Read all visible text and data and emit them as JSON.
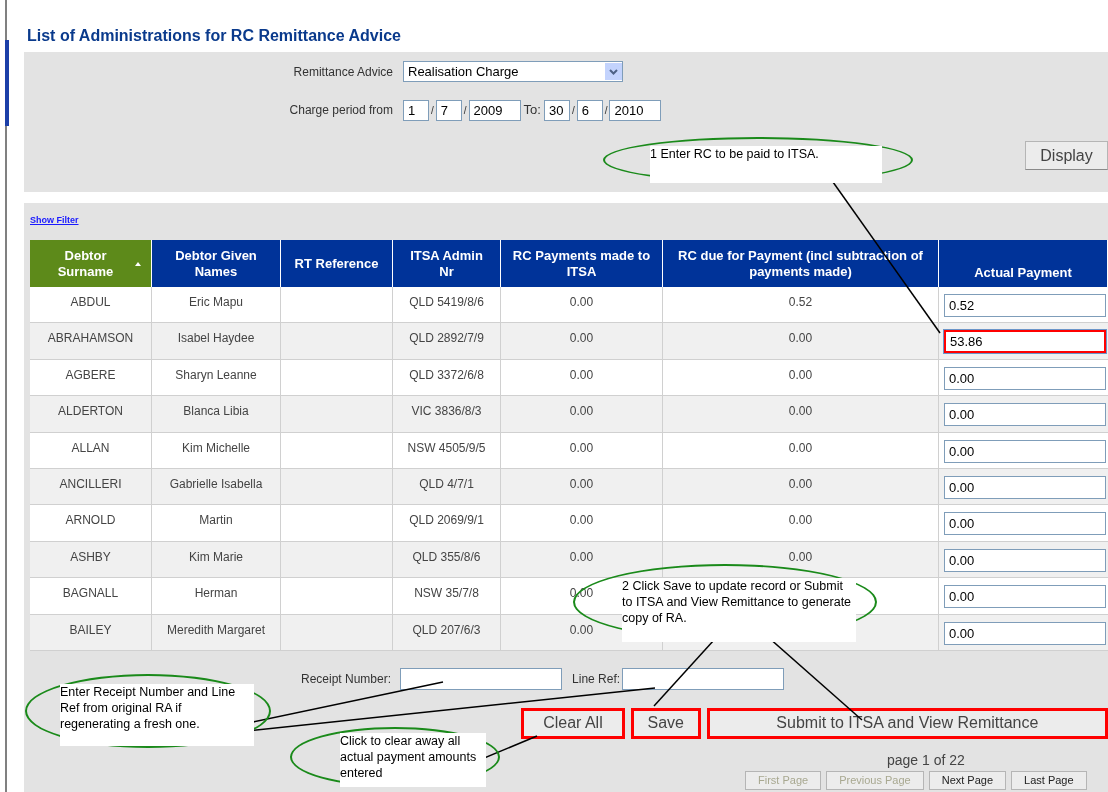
{
  "title": "List of Administrations for RC Remittance Advice",
  "filter": {
    "remittance_label": "Remittance Advice",
    "remittance_value": "Realisation Charge",
    "period_label": "Charge period from",
    "from": [
      "1",
      "7",
      "2009"
    ],
    "separator": "/",
    "to_label": "To:",
    "to": [
      "30",
      "6",
      "2010"
    ],
    "display_button": "Display"
  },
  "show_filter": "Show Filter",
  "table": {
    "columns": [
      {
        "label": "Debtor Surname",
        "sorted": true
      },
      {
        "label": "Debtor Given Names",
        "sorted": false
      },
      {
        "label": "RT Reference",
        "sorted": false
      },
      {
        "label": "ITSA Admin Nr",
        "sorted": false
      },
      {
        "label": "RC Payments made to ITSA",
        "sorted": false
      },
      {
        "label": "RC due for Payment (incl subtraction of payments made)",
        "sorted": false
      },
      {
        "label": "Actual Payment",
        "sorted": false
      }
    ],
    "rows": [
      {
        "surname": "ABDUL",
        "given": "Eric Mapu",
        "itsa": "QLD 5419/8/6",
        "made": "0.00",
        "due": "0.52",
        "actual": "0.52",
        "highlighted": false
      },
      {
        "surname": "ABRAHAMSON",
        "given": "Isabel Haydee",
        "itsa": "QLD 2892/7/9",
        "made": "0.00",
        "due": "0.00",
        "actual": "53.86",
        "highlighted": true
      },
      {
        "surname": "AGBERE",
        "given": "Sharyn Leanne",
        "itsa": "QLD 3372/6/8",
        "made": "0.00",
        "due": "0.00",
        "actual": "0.00",
        "highlighted": false
      },
      {
        "surname": "ALDERTON",
        "given": "Blanca Libia",
        "itsa": "VIC 3836/8/3",
        "made": "0.00",
        "due": "0.00",
        "actual": "0.00",
        "highlighted": false
      },
      {
        "surname": "ALLAN",
        "given": "Kim Michelle",
        "itsa": "NSW 4505/9/5",
        "made": "0.00",
        "due": "0.00",
        "actual": "0.00",
        "highlighted": false
      },
      {
        "surname": "ANCILLERI",
        "given": "Gabrielle Isabella",
        "itsa": "QLD 4/7/1",
        "made": "0.00",
        "due": "0.00",
        "actual": "0.00",
        "highlighted": false
      },
      {
        "surname": "ARNOLD",
        "given": "Martin",
        "itsa": "QLD 2069/9/1",
        "made": "0.00",
        "due": "0.00",
        "actual": "0.00",
        "highlighted": false
      },
      {
        "surname": "ASHBY",
        "given": "Kim Marie",
        "itsa": "QLD 355/8/6",
        "made": "0.00",
        "due": "0.00",
        "actual": "0.00",
        "highlighted": false
      },
      {
        "surname": "BAGNALL",
        "given": "Herman",
        "itsa": "NSW 35/7/8",
        "made": "0.00",
        "actual": "0.00",
        "highlighted": false
      },
      {
        "surname": "BAILEY",
        "given": "Meredith Margaret",
        "itsa": "QLD 207/6/3",
        "made": "0.00",
        "actual": "0.00",
        "highlighted": false
      }
    ]
  },
  "receipt_label": "Receipt Number:",
  "line_ref_label": "Line Ref:",
  "buttons": [
    {
      "label": "Clear All",
      "highlighted": true
    },
    {
      "label": "Save",
      "highlighted": true
    },
    {
      "label": "Submit to ITSA and View Remittance",
      "highlighted": true
    }
  ],
  "page_info": "page 1 of 22",
  "pager": [
    {
      "label": "First Page",
      "disabled": true
    },
    {
      "label": "Previous Page",
      "disabled": true
    },
    {
      "label": "Next Page",
      "disabled": false
    },
    {
      "label": "Last Page",
      "disabled": false
    }
  ],
  "callouts": [
    {
      "text": "1 Enter RC to be paid to ITSA."
    },
    {
      "text": "2 Click Save to update record or Submit to ITSA and View Remittance to generate copy of RA."
    },
    {
      "text": "Enter Receipt Number and Line Ref from original RA if regenerating a fresh one."
    },
    {
      "text": "Click to clear away all actual payment amounts entered"
    }
  ]
}
